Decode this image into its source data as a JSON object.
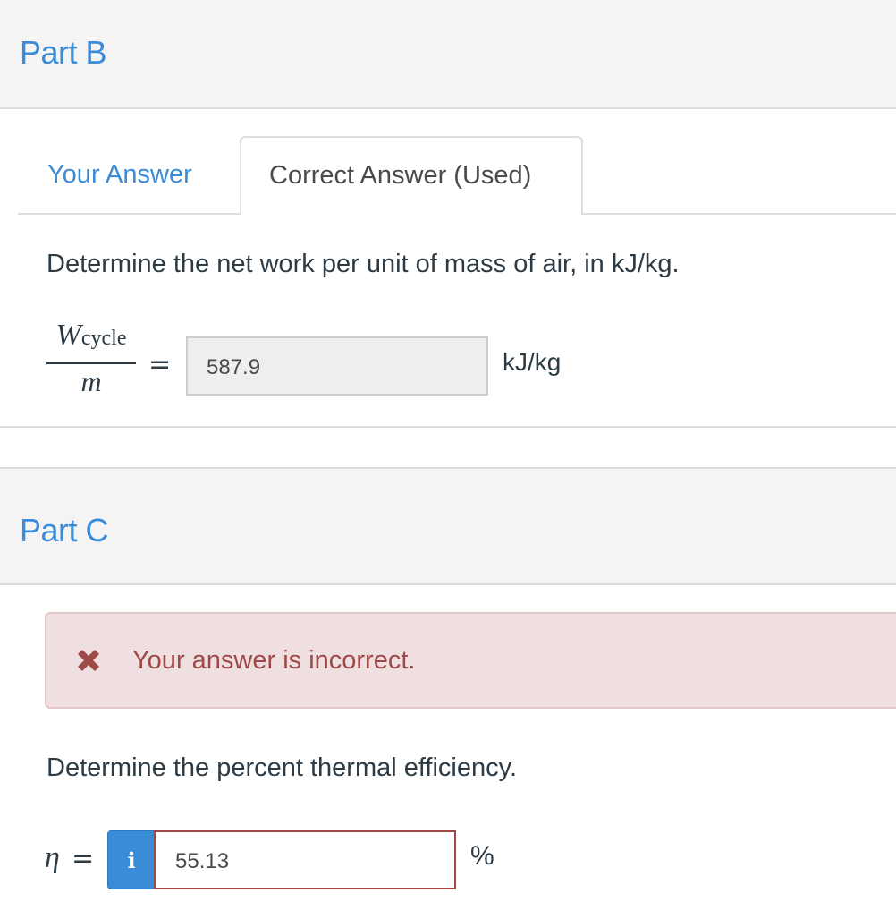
{
  "partB": {
    "title": "Part B",
    "tabs": [
      {
        "label": "Your Answer",
        "active": false
      },
      {
        "label": "Correct Answer (Used)",
        "active": true
      }
    ],
    "question": "Determine the net work per unit of mass of air, in kJ/kg.",
    "formula": {
      "numerator": "W",
      "numerator_subscript": "cycle",
      "denominator": "m",
      "equals": "="
    },
    "answer_value": "587.9",
    "unit": "kJ/kg"
  },
  "partC": {
    "title": "Part C",
    "alert": {
      "icon": "x-icon",
      "text": "Your answer is incorrect.",
      "color": "#9e4a47"
    },
    "question": "Determine the percent thermal efficiency.",
    "variable": "η",
    "equals": "=",
    "info_button_label": "i",
    "answer_value": "55.13",
    "unit": "%"
  },
  "colors": {
    "accent": "#3a8bd8",
    "error": "#9e4a47",
    "alert_bg": "#efdfe0",
    "header_bg": "#f4f4f4"
  }
}
